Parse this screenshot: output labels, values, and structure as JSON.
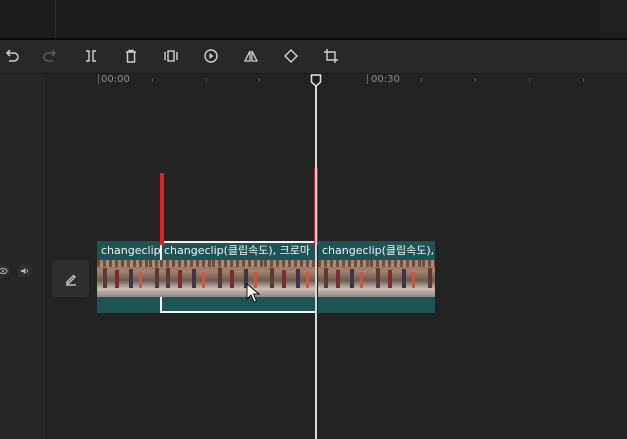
{
  "toolbar": {
    "tools": [
      {
        "name": "undo-icon"
      },
      {
        "name": "redo-icon"
      },
      {
        "name": "split-icon"
      },
      {
        "name": "delete-icon"
      },
      {
        "name": "freeze-frame-icon"
      },
      {
        "name": "reverse-play-icon"
      },
      {
        "name": "mirror-icon"
      },
      {
        "name": "rotate-icon"
      },
      {
        "name": "crop-icon"
      }
    ]
  },
  "ruler": {
    "labels": [
      "00:00",
      "00:30"
    ]
  },
  "clips": [
    {
      "label": "changeclip(클립속도), 크로마"
    },
    {
      "label": "changeclip(클립속도), 크로마"
    },
    {
      "label": "changeclip(클립속도),"
    }
  ],
  "colors": {
    "clip": "#1f5456",
    "marker": "#e01e26",
    "playhead": "#d8d8d8",
    "selection": "#f2f2f2"
  }
}
